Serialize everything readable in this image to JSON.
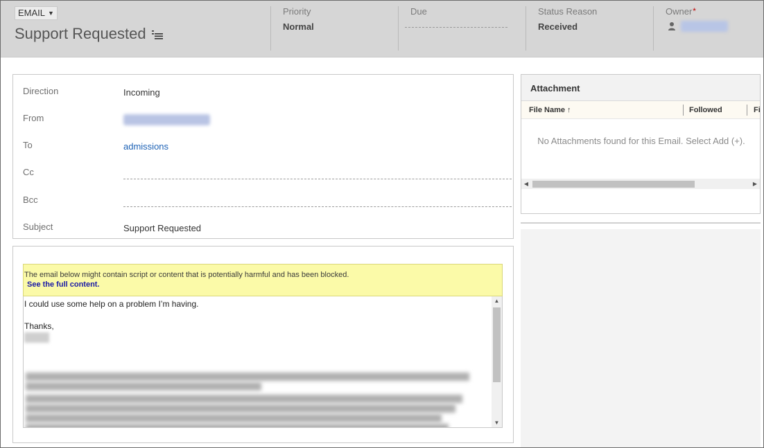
{
  "header": {
    "entity_type": "EMAIL",
    "record_title": "Support Requested",
    "fields": [
      {
        "label": "Priority",
        "value": "Normal"
      },
      {
        "label": "Due",
        "value": ""
      },
      {
        "label": "Status Reason",
        "value": "Received"
      },
      {
        "label": "Owner",
        "value": "",
        "required_mark": "*"
      }
    ]
  },
  "details": {
    "direction": {
      "label": "Direction",
      "value": "Incoming"
    },
    "from": {
      "label": "From",
      "value": ""
    },
    "to": {
      "label": "To",
      "value": "admissions"
    },
    "cc": {
      "label": "Cc",
      "value": ""
    },
    "bcc": {
      "label": "Bcc",
      "value": ""
    },
    "subject": {
      "label": "Subject",
      "value": "Support Requested"
    }
  },
  "description": {
    "warning_text": "The email below might contain script or content that is potentially harmful and has been blocked.",
    "warning_link": "See the full content.",
    "body_line1": "I could use some help on a problem I’m having.",
    "body_line2": "Thanks,"
  },
  "attachment": {
    "title": "Attachment",
    "columns": [
      "File Name ↑",
      "Followed",
      "Fi"
    ],
    "empty_message": "No Attachments found for this Email. Select Add (+)."
  },
  "colors": {
    "header_bg": "#d6d6d6",
    "warning_bg": "#fbfaa8",
    "link": "#1c61b5",
    "required": "#c00000"
  }
}
